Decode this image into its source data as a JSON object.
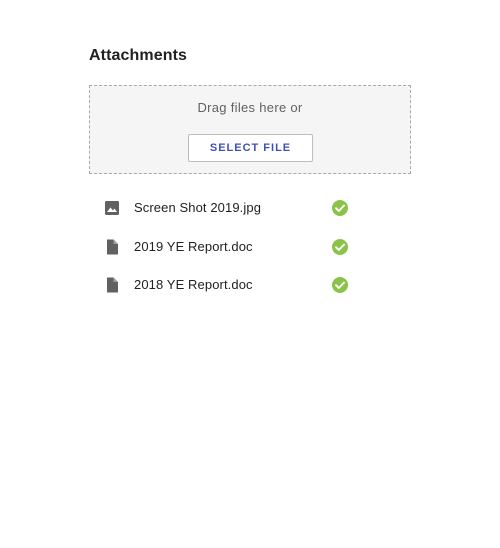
{
  "attachments": {
    "title": "Attachments",
    "dropzone": {
      "text": "Drag files here or",
      "button_label": "SELECT FILE"
    },
    "files": [
      {
        "name": "Screen Shot 2019.jpg",
        "type_icon": "image-icon",
        "status_icon": "check-circle-icon",
        "status": "uploaded"
      },
      {
        "name": "2019 YE Report.doc",
        "type_icon": "document-icon",
        "status_icon": "check-circle-icon",
        "status": "uploaded"
      },
      {
        "name": "2018 YE Report.doc",
        "type_icon": "document-icon",
        "status_icon": "check-circle-icon",
        "status": "uploaded"
      }
    ]
  },
  "colors": {
    "accent": "#3f51b5",
    "success": "#8bc34a",
    "icon": "#616161",
    "dropzone_bg": "#f5f5f5",
    "dropzone_border": "#a9a9a9"
  }
}
